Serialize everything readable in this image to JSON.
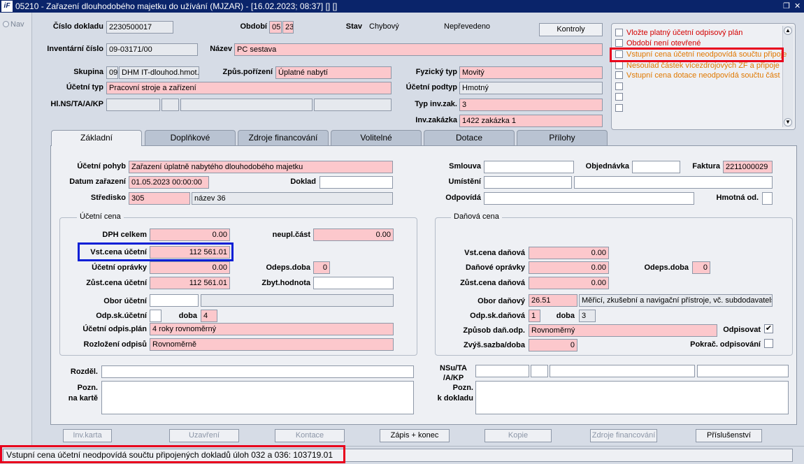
{
  "window": {
    "title": "05210 - Zařazení dlouhodobého majetku do užívání (MJZAR) - [16.02.2023; 08:37]  [] []",
    "logo_text": "iF"
  },
  "nav": {
    "label": "Nav"
  },
  "header": {
    "cislo_dokladu_label": "Číslo dokladu",
    "cislo_dokladu": "2230500017",
    "obdobi_label": "Období",
    "obdobi_month": "05",
    "obdobi_year": "23",
    "stav_label": "Stav",
    "stav_value": "Chybový",
    "stav_value2": "Nepřevedeno",
    "kontroly_button": "Kontroly",
    "inventarni_cislo_label": "Inventární číslo",
    "inventarni_cislo": "09-03171/00",
    "nazev_label": "Název",
    "nazev": "PC sestava",
    "skupina_label": "Skupina",
    "skupina_code": "09",
    "skupina_name": "DHM IT-dlouhod.hmot.m",
    "zpus_porizeni_label": "Způs.pořízení",
    "zpus_porizeni": "Úplatné nabytí",
    "fyzicky_typ_label": "Fyzický typ",
    "fyzicky_typ": "Movitý",
    "ucetni_typ_label": "Účetní typ",
    "ucetni_typ": "Pracovní stroje a zařízení",
    "ucetni_podtyp_label": "Účetní podtyp",
    "ucetni_podtyp": "Hmotný",
    "hins_label": "Hl.NS/TA/A/KP",
    "typ_inv_zak_label": "Typ inv.zak.",
    "typ_inv_zak": "3",
    "inv_zakazka_label": "Inv.zakázka",
    "inv_zakazka": "1422 zakázka 1"
  },
  "messages": [
    {
      "text": "Vložte platný účetní odpisový plán",
      "color": "#d40000"
    },
    {
      "text": "Období není otevřené",
      "color": "#d40000"
    },
    {
      "text": "Vstupní cena účetní neodpovídá součtu připoje",
      "color": "#e07800"
    },
    {
      "text": "Nesoulad částek vícezdrojových ZF a připoje",
      "color": "#e07800"
    },
    {
      "text": "Vstupní cena dotace neodpovídá součtu část",
      "color": "#e07800"
    },
    {
      "text": ""
    },
    {
      "text": ""
    },
    {
      "text": ""
    }
  ],
  "tabs": [
    "Základní",
    "Doplňkové",
    "Zdroje financování",
    "Volitelné",
    "Dotace",
    "Přílohy"
  ],
  "zakladni": {
    "ucetni_pohyb_label": "Účetní pohyb",
    "ucetni_pohyb": "Zařazení úplatně nabytého dlouhodobého majetku",
    "datum_zarazeni_label": "Datum zařazení",
    "datum_zarazeni": "01.05.2023 00:00:00",
    "doklad_label": "Doklad",
    "stredisko_label": "Středisko",
    "stredisko_code": "305",
    "stredisko_name": "název 36",
    "smlouva_label": "Smlouva",
    "objednavka_label": "Objednávka",
    "faktura_label": "Faktura",
    "faktura": "2211000029",
    "umisteni_label": "Umístění",
    "odpovida_label": "Odpovídá",
    "hmotna_od_label": "Hmotná od."
  },
  "ucetni_cena": {
    "group_title": "Účetní cena",
    "dph_celkem_label": "DPH celkem",
    "dph_celkem": "0.00",
    "neupl_cast_label": "neupl.část",
    "neupl_cast": "0.00",
    "vst_cena_label": "Vst.cena účetní",
    "vst_cena": "112 561.01",
    "ucetni_opravky_label": "Účetní oprávky",
    "ucetni_opravky": "0.00",
    "odeps_doba_label": "Odeps.doba",
    "odeps_doba": "0",
    "zust_cena_label": "Zůst.cena účetní",
    "zust_cena": "112 561.01",
    "zbyt_hodnota_label": "Zbyt.hodnota",
    "obor_label": "Obor účetní",
    "odp_sk_label": "Odp.sk.účetní",
    "doba_label": "doba",
    "doba": "4",
    "odpis_plan_label": "Účetní odpis.plán",
    "odpis_plan": "4 roky rovnoměrný",
    "rozlozeni_label": "Rozložení odpisů",
    "rozlozeni": "Rovnoměrně"
  },
  "danova_cena": {
    "group_title": "Daňová cena",
    "vst_cena_label": "Vst.cena daňová",
    "vst_cena": "0.00",
    "danove_opravky_label": "Daňové oprávky",
    "danove_opravky": "0.00",
    "odeps_doba_label": "Odeps.doba",
    "odeps_doba": "0",
    "zust_cena_label": "Zůst.cena daňová",
    "zust_cena": "0.00",
    "obor_label": "Obor daňový",
    "obor_code": "26.51",
    "obor_name": "Měřicí, zkušební a navigační přístroje, vč. subdodavatelsl",
    "odp_sk_label": "Odp.sk.daňová",
    "odp_sk": "1",
    "doba_label": "doba",
    "doba": "3",
    "zpusob_label": "Způsob daň.odp.",
    "zpusob": "Rovnoměrný",
    "odpisovat_label": "Odpisovat",
    "odpisovat_checked": "✔",
    "zvys_sazba_label": "Zvýš.sazba/doba",
    "zvys_sazba": "0",
    "pokrac_label": "Pokrač. odpisování"
  },
  "bottom": {
    "rozdel_label": "Rozděl.",
    "pozn_karte_label1": "Pozn.",
    "pozn_karte_label2": "na kartě",
    "nsu_label1": "NSu/TA",
    "nsu_label2": "/A/KP",
    "pozn_dokladu_label1": "Pozn.",
    "pozn_dokladu_label2": "k dokladu"
  },
  "buttons": {
    "inv_karta": "Inv.karta",
    "uzavreni": "Uzavření",
    "kontace": "Kontace",
    "zapis_konec": "Zápis + konec",
    "kopie": "Kopie",
    "zdroje_financovani": "Zdroje financování",
    "prislusenstvi": "Příslušenství"
  },
  "status": {
    "text": "Vstupní cena účetní neodpovídá součtu připojených dokladů úloh 032 a 036: 103719.01"
  },
  "colors": {
    "required_field": "#fcc8cc",
    "highlight_red": "#e8001c",
    "highlight_blue": "#0a1fd6",
    "titlebar": "#0a246a"
  }
}
